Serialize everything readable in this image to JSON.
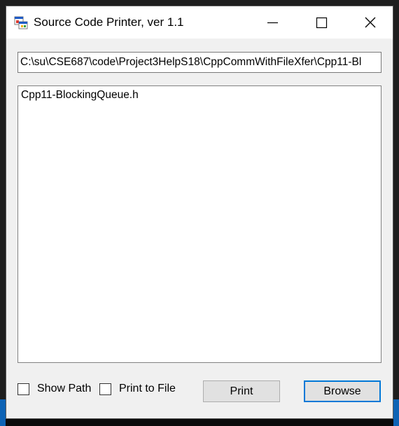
{
  "window": {
    "title": "Source Code Printer, ver 1.1",
    "icon": "app-window-icon",
    "controls": {
      "minimize": "minimize-icon",
      "maximize": "maximize-icon",
      "close": "close-icon"
    }
  },
  "path_field": {
    "value": "C:\\su\\CSE687\\code\\Project3HelpS18\\CppCommWithFileXfer\\Cpp11-Bl"
  },
  "file_list": {
    "items": [
      "Cpp11-BlockingQueue.h"
    ]
  },
  "options": {
    "show_path": {
      "label": "Show Path",
      "checked": false
    },
    "print_to_file": {
      "label": "Print to File",
      "checked": false
    }
  },
  "buttons": {
    "print": "Print",
    "browse": "Browse"
  },
  "colors": {
    "focus_border": "#0078d7",
    "button_face": "#e1e1e1",
    "window_bg": "#f0f0f0"
  }
}
